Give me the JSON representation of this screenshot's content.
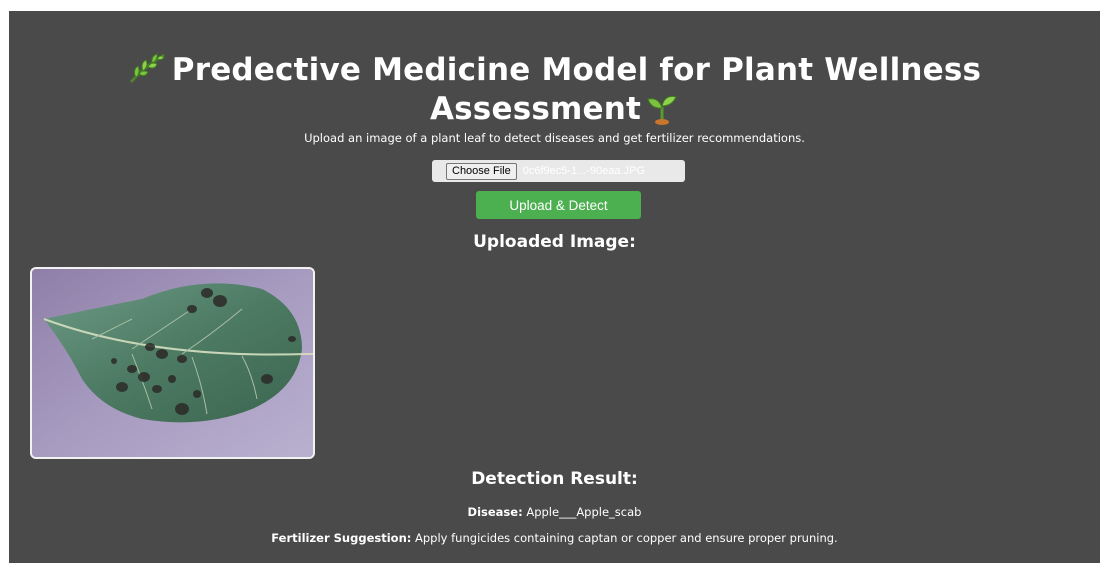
{
  "header": {
    "title_line1": "Predective Medicine Model for Plant Wellness",
    "title_line2": "Assessment",
    "subtitle": "Upload an image of a plant leaf to detect diseases and get fertilizer recommendations."
  },
  "icons": {
    "leading": "herb-leaf-icon",
    "trailing": "seedling-icon"
  },
  "form": {
    "choose_file_label": "Choose File",
    "selected_file": "0c6f9ec5-1...-90eaa.JPG",
    "upload_button_label": "Upload & Detect"
  },
  "uploaded": {
    "heading": "Uploaded Image:"
  },
  "result": {
    "heading": "Detection Result:",
    "disease_label": "Disease:",
    "disease_value": "Apple___Apple_scab",
    "fertilizer_label": "Fertilizer Suggestion:",
    "fertilizer_value": "Apply fungicides containing captan or copper and ensure proper pruning."
  },
  "colors": {
    "background": "#4a4a4a",
    "accent_button": "#4caf50",
    "text": "#ffffff"
  }
}
